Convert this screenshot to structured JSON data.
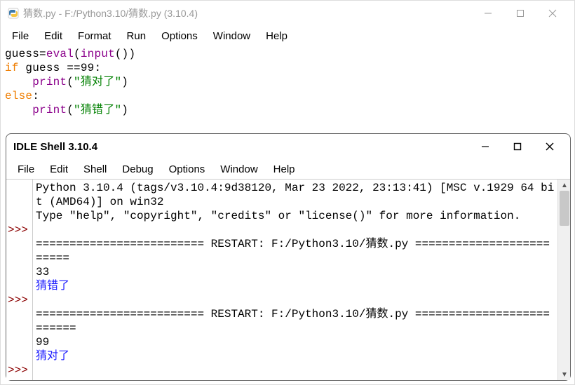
{
  "editor": {
    "title": "猜数.py - F:/Python3.10/猜数.py (3.10.4)",
    "menu": [
      "File",
      "Edit",
      "Format",
      "Run",
      "Options",
      "Window",
      "Help"
    ],
    "code_tokens": [
      [
        {
          "t": "id",
          "v": "guess"
        },
        {
          "t": "op",
          "v": "="
        },
        {
          "t": "func",
          "v": "eval"
        },
        {
          "t": "op",
          "v": "("
        },
        {
          "t": "func",
          "v": "input"
        },
        {
          "t": "op",
          "v": "())"
        }
      ],
      [
        {
          "t": "kw",
          "v": "if"
        },
        {
          "t": "id",
          "v": " guess "
        },
        {
          "t": "op",
          "v": "=="
        },
        {
          "t": "num",
          "v": "99"
        },
        {
          "t": "op",
          "v": ":"
        }
      ],
      [
        {
          "t": "id",
          "v": "    "
        },
        {
          "t": "func",
          "v": "print"
        },
        {
          "t": "op",
          "v": "("
        },
        {
          "t": "str",
          "v": "\"猜对了\""
        },
        {
          "t": "op",
          "v": ")"
        }
      ],
      [
        {
          "t": "kw",
          "v": "else"
        },
        {
          "t": "op",
          "v": ":"
        }
      ],
      [
        {
          "t": "id",
          "v": "    "
        },
        {
          "t": "func",
          "v": "print"
        },
        {
          "t": "op",
          "v": "("
        },
        {
          "t": "str",
          "v": "\"猜错了\""
        },
        {
          "t": "op",
          "v": ")"
        }
      ]
    ]
  },
  "shell": {
    "title": "IDLE Shell 3.10.4",
    "menu": [
      "File",
      "Edit",
      "Shell",
      "Debug",
      "Options",
      "Window",
      "Help"
    ],
    "lines": [
      {
        "prompt": "",
        "text": "Python 3.10.4 (tags/v3.10.4:9d38120, Mar 23 2022, 23:13:41) [MSC v.1929 64 bit (AMD64)] on win32",
        "cls": ""
      },
      {
        "prompt": "",
        "text": "Type \"help\", \"copyright\", \"credits\" or \"license()\" for more information.",
        "cls": ""
      },
      {
        "prompt": ">>>",
        "text": "",
        "cls": ""
      },
      {
        "prompt": "",
        "text": "========================= RESTART: F:/Python3.10/猜数.py =========================",
        "cls": ""
      },
      {
        "prompt": "",
        "text": "33",
        "cls": ""
      },
      {
        "prompt": "",
        "text": "猜错了",
        "cls": "out-blue"
      },
      {
        "prompt": ">>>",
        "text": "",
        "cls": ""
      },
      {
        "prompt": "",
        "text": "========================= RESTART: F:/Python3.10/猜数.py ==========================",
        "cls": ""
      },
      {
        "prompt": "",
        "text": "99",
        "cls": ""
      },
      {
        "prompt": "",
        "text": "猜对了",
        "cls": "out-blue"
      },
      {
        "prompt": ">>>",
        "text": "",
        "cls": ""
      }
    ]
  }
}
